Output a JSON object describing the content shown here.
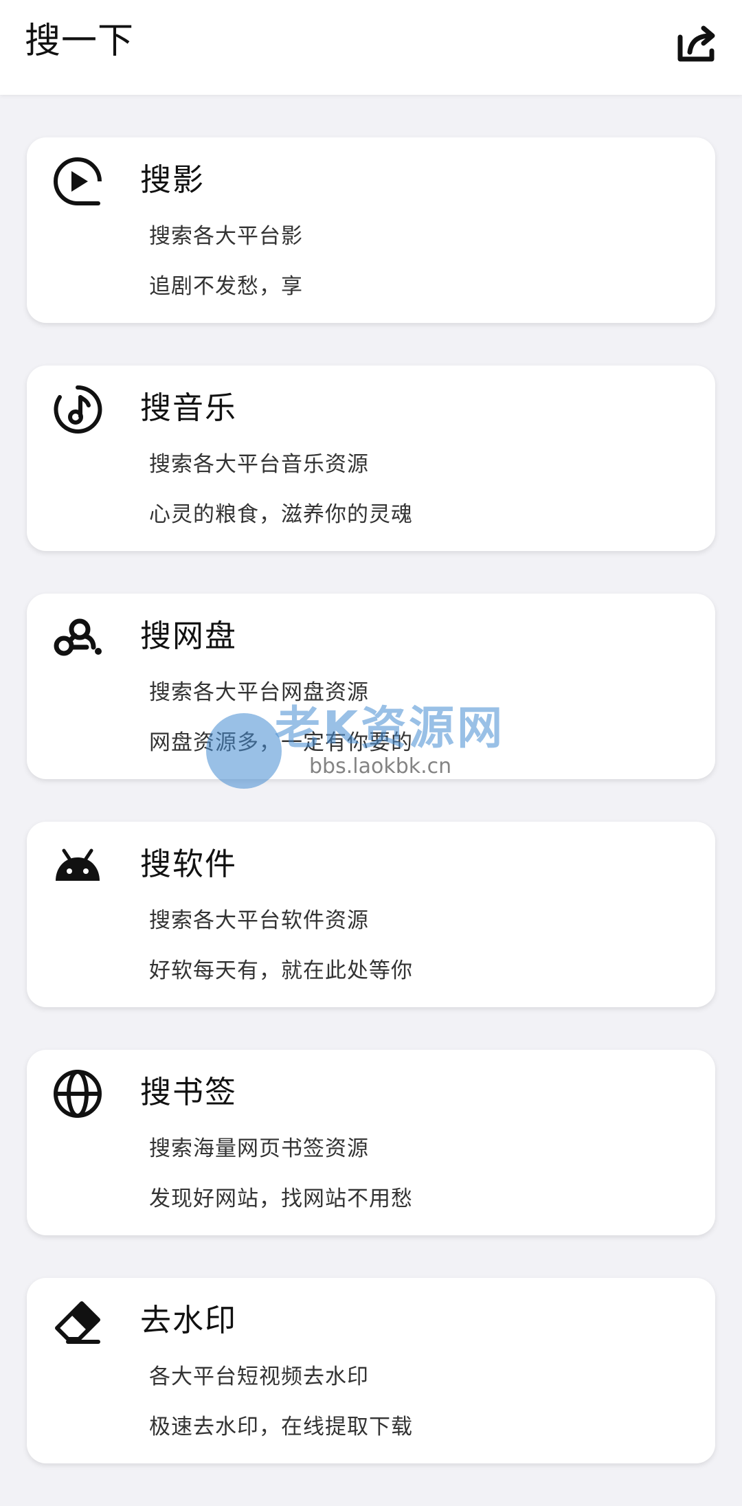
{
  "header": {
    "title": "搜一下",
    "share_icon": "share-icon"
  },
  "cards": [
    {
      "icon": "play-icon",
      "title": "搜影",
      "line1": "搜索各大平台影",
      "line2": "追剧不发愁，享"
    },
    {
      "icon": "music-note-icon",
      "title": "搜音乐",
      "line1": "搜索各大平台音乐资源",
      "line2": "心灵的粮食，滋养你的灵魂"
    },
    {
      "icon": "cloud-link-icon",
      "title": "搜网盘",
      "line1": "搜索各大平台网盘资源",
      "line2": "网盘资源多，一定有你要的"
    },
    {
      "icon": "android-icon",
      "title": "搜软件",
      "line1": "搜索各大平台软件资源",
      "line2": "好软每天有，就在此处等你"
    },
    {
      "icon": "globe-icon",
      "title": "搜书签",
      "line1": "搜索海量网页书签资源",
      "line2": "发现好网站，找网站不用愁"
    },
    {
      "icon": "eraser-icon",
      "title": "去水印",
      "line1": "各大平台短视频去水印",
      "line2": "极速去水印，在线提取下载"
    }
  ],
  "watermark": {
    "text": "老K资源网",
    "url": "bbs.laokbk.cn"
  },
  "colors": {
    "background": "#f2f2f6",
    "card": "#ffffff",
    "text": "#111111"
  }
}
